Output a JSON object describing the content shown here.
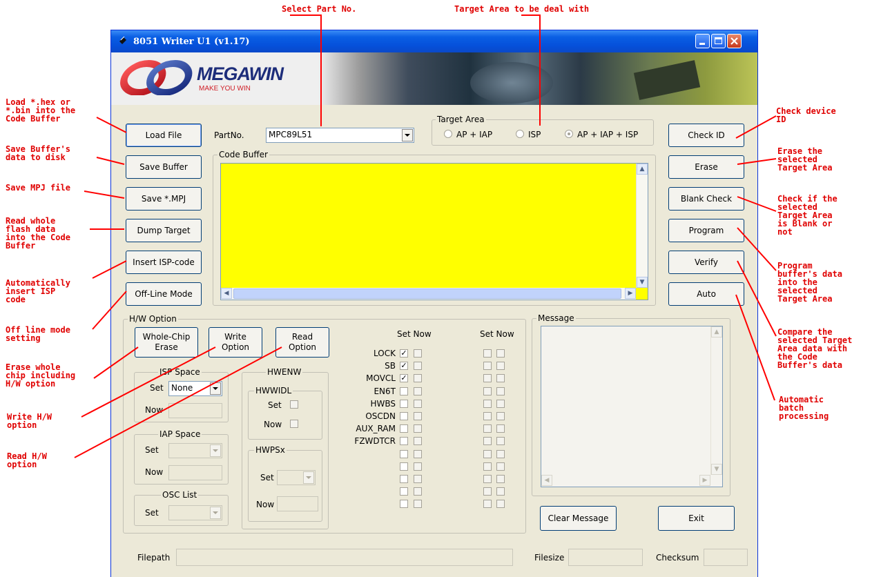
{
  "annotations": {
    "select_part": "Select Part No.",
    "target_area": "Target Area to be deal with",
    "load_file": "Load *.hex or\n*.bin into the\nCode Buffer",
    "save_buffer": "Save Buffer's\ndata to disk",
    "save_mpj": "Save MPJ file",
    "dump_target": "Read whole\nflash data\ninto the Code\nBuffer",
    "insert_isp": "Automatically\ninsert ISP\ncode",
    "offline": "Off line mode\nsetting",
    "whole_erase": "Erase whole\nchip including\nH/W option",
    "write_option": "Write H/W\noption",
    "read_option": "Read H/W\noption",
    "check_id": "Check device\nID",
    "erase": "Erase the\nselected\nTarget Area",
    "blank_check": "Check if the\nselected\nTarget Area\nis Blank or\nnot",
    "program": "Program\nbuffer's data\ninto the\nselected\nTarget Area",
    "verify": "Compare the\nselected Target\nArea data with\nthe Code\nBuffer's data",
    "auto": "Automatic\nbatch\nprocessing"
  },
  "window": {
    "title": "8051 Writer U1 (v1.17)",
    "brand": "MEGAWIN",
    "slogan": "MAKE YOU WIN"
  },
  "buttons": {
    "load_file": "Load File",
    "save_buffer": "Save Buffer",
    "save_mpj": "Save *.MPJ",
    "dump_target": "Dump Target",
    "insert_isp": "Insert ISP-code",
    "offline": "Off-Line Mode",
    "check_id": "Check ID",
    "erase": "Erase",
    "blank_check": "Blank Check",
    "program": "Program",
    "verify": "Verify",
    "auto": "Auto",
    "whole_erase_1": "Whole-Chip",
    "whole_erase_2": "Erase",
    "write_option_1": "Write",
    "write_option_2": "Option",
    "read_option_1": "Read",
    "read_option_2": "Option",
    "clear_message": "Clear Message",
    "exit": "Exit"
  },
  "part": {
    "label": "PartNo.",
    "value": "MPC89L51"
  },
  "target_area": {
    "title": "Target Area",
    "options": [
      "AP + IAP",
      "ISP",
      "AP + IAP + ISP"
    ],
    "selected": "AP + IAP + ISP"
  },
  "code_buffer": {
    "title": "Code Buffer"
  },
  "hw_option": {
    "title": "H/W Option",
    "isp_space": {
      "title": "ISP Space",
      "set_label": "Set",
      "set_value": "None",
      "now_label": "Now"
    },
    "iap_space": {
      "title": "IAP Space",
      "set_label": "Set",
      "now_label": "Now"
    },
    "osc_list": {
      "title": "OSC List",
      "set_label": "Set"
    },
    "hwenw": {
      "title": "HWENW"
    },
    "hwwidl": {
      "title": "HWWIDL",
      "set_label": "Set",
      "now_label": "Now"
    },
    "hwpsx": {
      "title": "HWPSx",
      "set_label": "Set",
      "now_label": "Now"
    },
    "set_now_header_1": "Set Now",
    "set_now_header_2": "Set Now",
    "flags": [
      "LOCK",
      "SB",
      "MOVCL",
      "EN6T",
      "HWBS",
      "OSCDN",
      "AUX_RAM",
      "FZWDTCR"
    ],
    "flags_checked": [
      true,
      true,
      true,
      false,
      false,
      false,
      false,
      false
    ]
  },
  "message": {
    "title": "Message"
  },
  "status": {
    "filepath_label": "Filepath",
    "filesize_label": "Filesize",
    "checksum_label": "Checksum"
  }
}
